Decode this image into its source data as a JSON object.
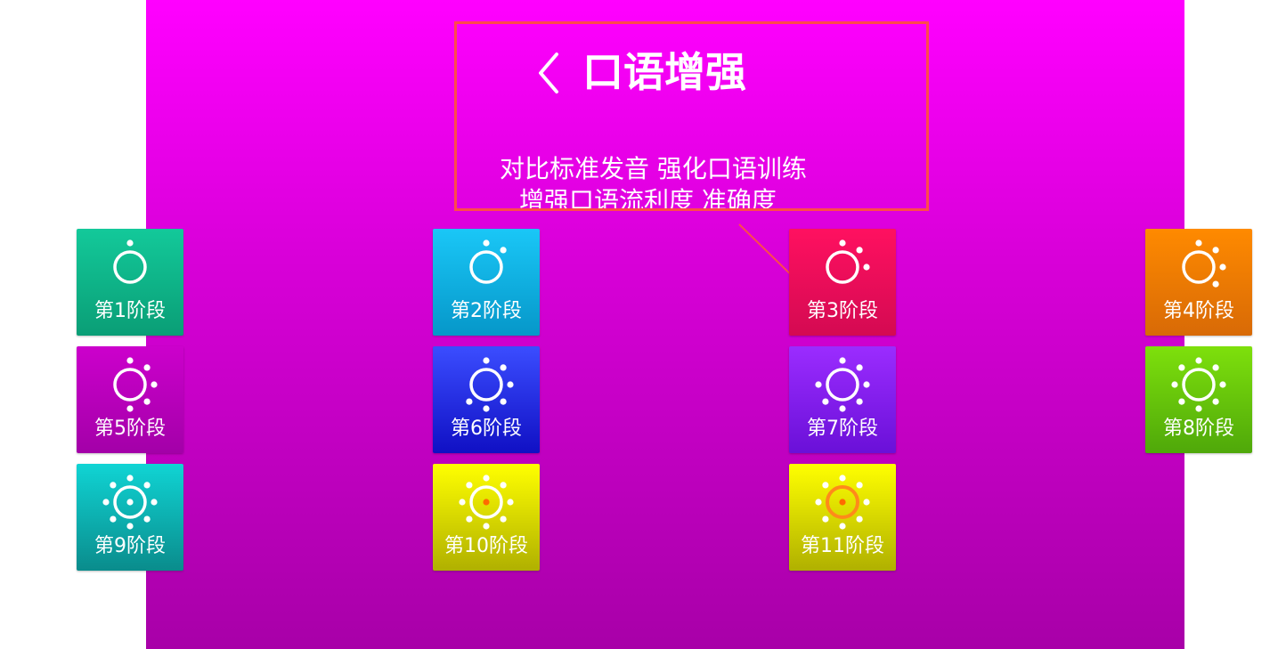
{
  "header": {
    "title": "口语增强",
    "subtitle": "对比标准发音 强化口语训练",
    "subtitle_cut": "增强口语流利度 准确度"
  },
  "stages": [
    {
      "label": "第1阶段",
      "rays": 1,
      "center": false,
      "ring": false,
      "colors": [
        "#13c99a",
        "#0a9e76"
      ]
    },
    {
      "label": "第2阶段",
      "rays": 2,
      "center": false,
      "ring": false,
      "colors": [
        "#1ac7f7",
        "#0697c9"
      ]
    },
    {
      "label": "第3阶段",
      "rays": 3,
      "center": false,
      "ring": false,
      "colors": [
        "#ff1060",
        "#d40a52"
      ]
    },
    {
      "label": "第4阶段",
      "rays": 4,
      "center": false,
      "ring": false,
      "colors": [
        "#ff8a00",
        "#d86a06"
      ]
    },
    {
      "label": "第5阶段",
      "rays": 5,
      "center": false,
      "ring": false,
      "colors": [
        "#cc00cc",
        "#a300a8"
      ]
    },
    {
      "label": "第6阶段",
      "rays": 6,
      "center": false,
      "ring": false,
      "colors": [
        "#3b4dff",
        "#1010c4"
      ]
    },
    {
      "label": "第7阶段",
      "rays": 7,
      "center": false,
      "ring": false,
      "colors": [
        "#9b2cff",
        "#6a10d8"
      ]
    },
    {
      "label": "第8阶段",
      "rays": 8,
      "center": false,
      "ring": false,
      "colors": [
        "#7ee00c",
        "#4fa80a"
      ]
    },
    {
      "label": "第9阶段",
      "rays": 8,
      "center": true,
      "ring": false,
      "colors": [
        "#10d4d4",
        "#0a8c8c"
      ]
    },
    {
      "label": "第10阶段",
      "rays": 8,
      "center": true,
      "ring": false,
      "colors": [
        "#ffff00",
        "#b0b000"
      ]
    },
    {
      "label": "第11阶段",
      "rays": 8,
      "center": true,
      "ring": true,
      "colors": [
        "#ffff00",
        "#b0b000"
      ]
    }
  ],
  "colors": {
    "background_top": "#ff00ff",
    "background_bottom": "#a800a8",
    "highlight_border": "#ff4a4a",
    "active_ring": "#ff8a1a",
    "active_dot": "#ff6a00"
  }
}
